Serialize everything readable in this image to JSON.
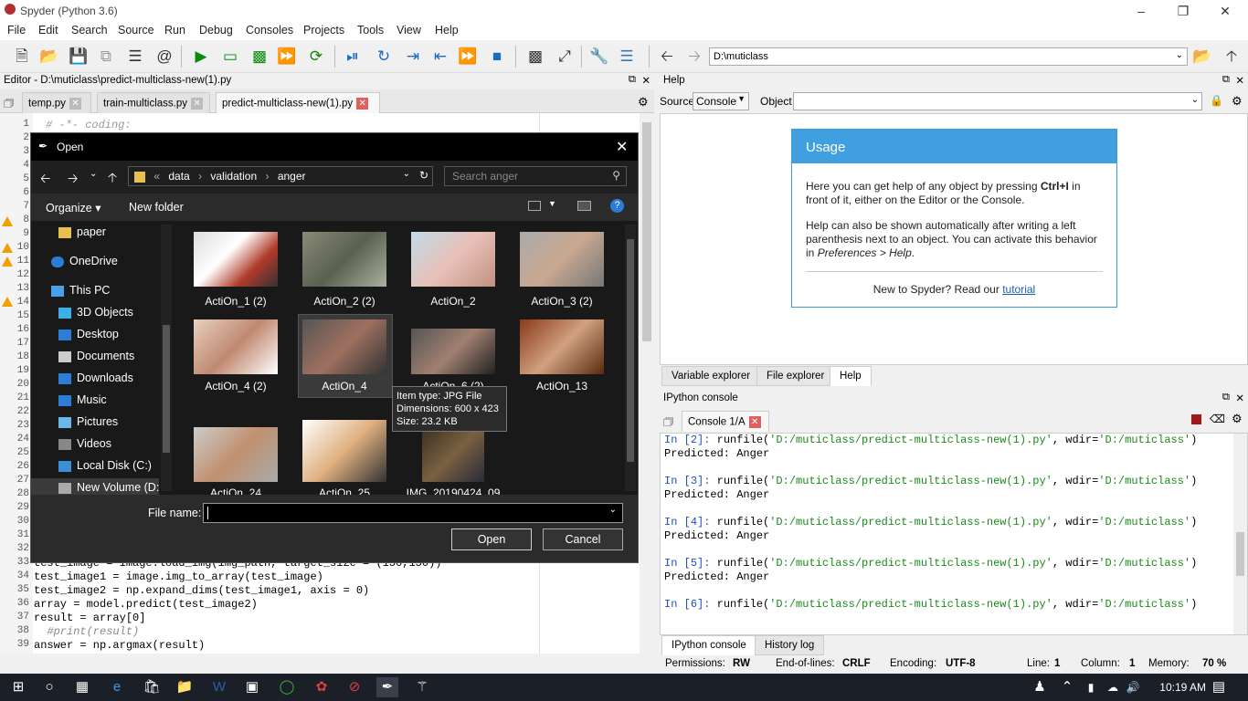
{
  "window": {
    "title": "Spyder (Python 3.6)"
  },
  "menu": [
    "File",
    "Edit",
    "Search",
    "Source",
    "Run",
    "Debug",
    "Consoles",
    "Projects",
    "Tools",
    "View",
    "Help"
  ],
  "toolbar": {
    "path": "D:\\muticlass"
  },
  "editor": {
    "header": "Editor - D:\\muticlass\\predict-multiclass-new(1).py",
    "tabs": [
      "temp.py",
      "train-multiclass.py",
      "predict-multiclass-new(1).py"
    ],
    "first_line": "# -*- coding:",
    "line_numbers": [
      "1",
      "2",
      "3",
      "4",
      "5",
      "6",
      "7",
      "8",
      "9",
      "10",
      "11",
      "12",
      "13",
      "14",
      "15",
      "16",
      "17",
      "18",
      "19",
      "20",
      "21",
      "22",
      "23",
      "24",
      "25",
      "26",
      "27",
      "28",
      "29",
      "30",
      "31",
      "32",
      "33",
      "34",
      "35",
      "36",
      "37",
      "38",
      "39"
    ],
    "code": [
      "test_image = image.load_img(img_path, target_size = (150,150))",
      "test_image1 = image.img_to_array(test_image)",
      "test_image2 = np.expand_dims(test_image1, axis = 0)",
      "array = model.predict(test_image2)",
      "result = array[0]",
      "  #print(result)",
      "answer = np.argmax(result)"
    ]
  },
  "help": {
    "header": "Help",
    "source_label": "Source",
    "source_value": "Console",
    "object_label": "Object",
    "usage_title": "Usage",
    "usage_p1a": "Here you can get help of any object by pressing ",
    "usage_p1b": "Ctrl+I",
    "usage_p1c": " in front of it, either on the Editor or the Console.",
    "usage_p2a": "Help can also be shown automatically after writing a left parenthesis next to an object. You can activate this behavior in ",
    "usage_p2b": "Preferences > Help",
    "usage_p2c": ".",
    "new_to": "New to Spyder? Read our ",
    "tutorial": "tutorial",
    "tabs": [
      "Variable explorer",
      "File explorer",
      "Help"
    ]
  },
  "ipython": {
    "header": "IPython console",
    "tab": "Console 1/A",
    "lines": [
      {
        "n": "2",
        "file": "'D:/muticlass/predict-multiclass-new(1).py'",
        "wdir": "'D:/muticlass'"
      },
      {
        "n": "3",
        "file": "'D:/muticlass/predict-multiclass-new(1).py'",
        "wdir": "'D:/muticlass'"
      },
      {
        "n": "4",
        "file": "'D:/muticlass/predict-multiclass-new(1).py'",
        "wdir": "'D:/muticlass'"
      },
      {
        "n": "5",
        "file": "'D:/muticlass/predict-multiclass-new(1).py'",
        "wdir": "'D:/muticlass'"
      },
      {
        "n": "6",
        "file": "'D:/muticlass/predict-multiclass-new(1).py'",
        "wdir": "'D:/muticlass'"
      }
    ],
    "predicted": "Predicted: Anger",
    "bottom_tabs": [
      "IPython console",
      "History log"
    ]
  },
  "status": {
    "perm_label": "Permissions:",
    "perm": "RW",
    "eol_label": "End-of-lines:",
    "eol": "CRLF",
    "enc_label": "Encoding:",
    "enc": "UTF-8",
    "line_label": "Line:",
    "line": "1",
    "col_label": "Column:",
    "col": "1",
    "mem_label": "Memory:",
    "mem": "70 %"
  },
  "dialog": {
    "title": "Open",
    "breadcrumb": [
      "data",
      "validation",
      "anger"
    ],
    "search_placeholder": "Search anger",
    "organize": "Organize",
    "new_folder": "New folder",
    "nav": [
      "paper",
      "OneDrive",
      "This PC",
      "3D Objects",
      "Desktop",
      "Documents",
      "Downloads",
      "Music",
      "Pictures",
      "Videos",
      "Local Disk (C:)",
      "New Volume (D:"
    ],
    "files": [
      "ActiOn_1 (2)",
      "ActiOn_2 (2)",
      "ActiOn_2",
      "ActiOn_3 (2)",
      "ActiOn_4 (2)",
      "ActiOn_4",
      "ActiOn_6 (2)",
      "ActiOn_13",
      "ActiOn_24",
      "ActiOn_25",
      "IMG_20190424_09"
    ],
    "tooltip": [
      "Item type: JPG File",
      "Dimensions: 600 x 423",
      "Size: 23.2 KB"
    ],
    "filename_label": "File name:",
    "open": "Open",
    "cancel": "Cancel"
  },
  "taskbar": {
    "time": "10:19 AM"
  }
}
